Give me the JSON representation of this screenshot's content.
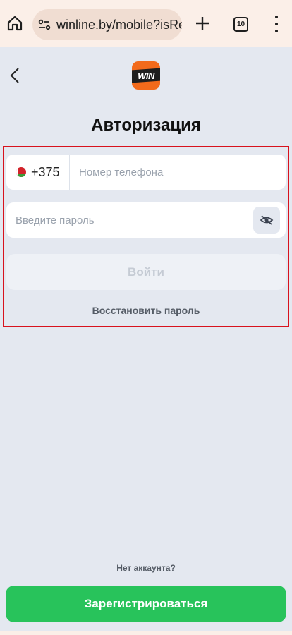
{
  "browser": {
    "url": "winline.by/mobile?isRe",
    "tab_count": "10",
    "icons": {
      "home": "home-icon",
      "site": "tune-icon",
      "new_tab": "plus-icon",
      "tabs": "tabs-icon",
      "menu": "more-vert-icon"
    }
  },
  "header": {
    "back_icon": "chevron-left-icon",
    "logo_text": "WIN"
  },
  "auth": {
    "title": "Авторизация",
    "phone": {
      "country_code": "+375",
      "placeholder": "Номер телефона",
      "value": ""
    },
    "password": {
      "placeholder": "Введите пароль",
      "value": "",
      "toggle_icon": "eye-off-icon"
    },
    "login_label": "Войти",
    "restore_label": "Восстановить пароль"
  },
  "footer": {
    "no_account": "Нет аккаунта?",
    "register_label": "Зарегистрироваться"
  },
  "colors": {
    "page_bg": "#e4e8f0",
    "accent_green": "#28c35b",
    "highlight_red": "#d8121d",
    "logo_orange": "#f26a1b"
  }
}
